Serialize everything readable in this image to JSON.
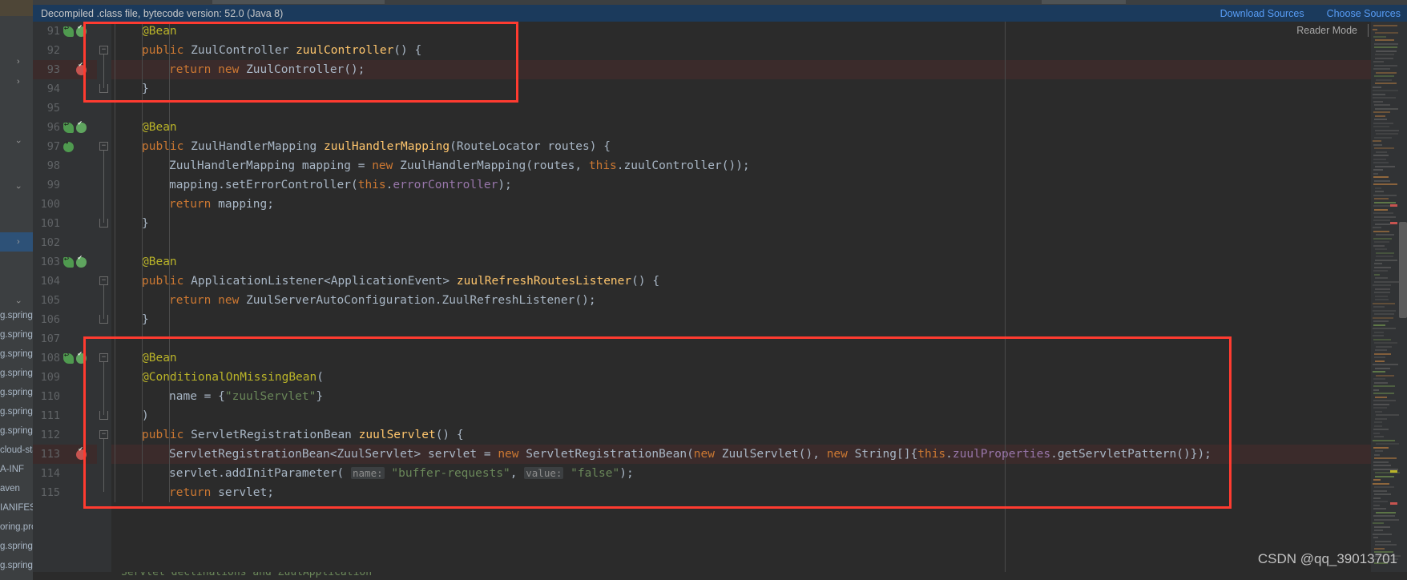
{
  "banner": {
    "message": "Decompiled .class file, bytecode version: 52.0 (Java 8)",
    "download_sources_label": "Download Sources",
    "choose_sources_label": "Choose Sources"
  },
  "editor": {
    "reader_mode_label": "Reader Mode",
    "first_line_number": 91,
    "lines": [
      {
        "num": "91",
        "indent": 1,
        "html": "<span class=\"anno\">@Bean</span>"
      },
      {
        "num": "92",
        "indent": 1,
        "html": "<span class=\"kw\">public</span> <span class=\"type\">ZuulController</span> <span class=\"mname\">zuulController</span><span class=\"punct\">() {</span>"
      },
      {
        "num": "93",
        "indent": 2,
        "html": "<span class=\"kw\">return</span> <span class=\"kw\">new</span> <span class=\"type\">ZuulController</span><span class=\"punct\">();</span>"
      },
      {
        "num": "94",
        "indent": 1,
        "html": "<span class=\"punct\">}</span>"
      },
      {
        "num": "95",
        "indent": 0,
        "html": ""
      },
      {
        "num": "96",
        "indent": 1,
        "html": "<span class=\"anno\">@Bean</span>"
      },
      {
        "num": "97",
        "indent": 1,
        "html": "<span class=\"kw\">public</span> <span class=\"type\">ZuulHandlerMapping</span> <span class=\"mname\">zuulHandlerMapping</span><span class=\"punct\">(</span><span class=\"type\">RouteLocator</span> <span class=\"ident\">routes</span><span class=\"punct\">) {</span>"
      },
      {
        "num": "98",
        "indent": 2,
        "html": "<span class=\"type\">ZuulHandlerMapping</span> <span class=\"ident\">mapping</span> <span class=\"punct\">=</span> <span class=\"kw\">new</span> <span class=\"type\">ZuulHandlerMapping</span><span class=\"punct\">(</span><span class=\"ident\">routes</span><span class=\"punct\">,</span> <span class=\"kw\">this</span><span class=\"punct\">.</span><span class=\"ident\">zuulController</span><span class=\"punct\">());</span>"
      },
      {
        "num": "99",
        "indent": 2,
        "html": "<span class=\"ident\">mapping</span><span class=\"punct\">.</span><span class=\"ident\">setErrorController</span><span class=\"punct\">(</span><span class=\"kw\">this</span><span class=\"punct\">.</span><span class=\"field\">errorController</span><span class=\"punct\">);</span>"
      },
      {
        "num": "100",
        "indent": 2,
        "html": "<span class=\"kw\">return</span> <span class=\"ident\">mapping</span><span class=\"punct\">;</span>"
      },
      {
        "num": "101",
        "indent": 1,
        "html": "<span class=\"punct\">}</span>"
      },
      {
        "num": "102",
        "indent": 0,
        "html": ""
      },
      {
        "num": "103",
        "indent": 1,
        "html": "<span class=\"anno\">@Bean</span>"
      },
      {
        "num": "104",
        "indent": 1,
        "html": "<span class=\"kw\">public</span> <span class=\"type\">ApplicationListener&lt;ApplicationEvent&gt;</span> <span class=\"mname\">zuulRefreshRoutesListener</span><span class=\"punct\">() {</span>"
      },
      {
        "num": "105",
        "indent": 2,
        "html": "<span class=\"kw\">return</span> <span class=\"kw\">new</span> <span class=\"type\">ZuulServerAutoConfiguration</span><span class=\"punct\">.</span><span class=\"type\">ZuulRefreshListener</span><span class=\"punct\">();</span>"
      },
      {
        "num": "106",
        "indent": 1,
        "html": "<span class=\"punct\">}</span>"
      },
      {
        "num": "107",
        "indent": 0,
        "html": ""
      },
      {
        "num": "108",
        "indent": 1,
        "html": "<span class=\"anno\">@Bean</span>"
      },
      {
        "num": "109",
        "indent": 1,
        "html": "<span class=\"anno\">@ConditionalOnMissingBean</span><span class=\"punct\">(</span>"
      },
      {
        "num": "110",
        "indent": 2,
        "html": "<span class=\"ident\">name</span> <span class=\"punct\">= {</span><span class=\"str\">\"zuulServlet\"</span><span class=\"punct\">}</span>"
      },
      {
        "num": "111",
        "indent": 1,
        "html": "<span class=\"punct\">)</span>"
      },
      {
        "num": "112",
        "indent": 1,
        "html": "<span class=\"kw\">public</span> <span class=\"type\">ServletRegistrationBean</span> <span class=\"mname\">zuulServlet</span><span class=\"punct\">() {</span>"
      },
      {
        "num": "113",
        "indent": 2,
        "html": "<span class=\"type\">ServletRegistrationBean&lt;ZuulServlet&gt;</span> <span class=\"ident\">servlet</span> <span class=\"punct\">=</span> <span class=\"kw\">new</span> <span class=\"type\">ServletRegistrationBean</span><span class=\"punct\">(</span><span class=\"kw\">new</span> <span class=\"type\">ZuulServlet</span><span class=\"punct\">(),</span> <span class=\"kw\">new</span> <span class=\"type\">String</span><span class=\"punct\">[]{</span><span class=\"kw\">this</span><span class=\"punct\">.</span><span class=\"field\">zuulProperties</span><span class=\"punct\">.</span><span class=\"ident\">getServletPattern</span><span class=\"punct\">()});</span>"
      },
      {
        "num": "114",
        "indent": 2,
        "html": "<span class=\"ident\">servlet</span><span class=\"punct\">.</span><span class=\"ident\">addInitParameter</span><span class=\"punct\">(</span> <span class=\"hintbg\">name:</span> <span class=\"str\">\"buffer-requests\"</span><span class=\"punct\">,</span> <span class=\"hintbg\">value:</span> <span class=\"str\">\"false\"</span><span class=\"punct\">);</span>"
      },
      {
        "num": "115",
        "indent": 2,
        "html": "<span class=\"kw\">return</span> <span class=\"ident\">servlet</span><span class=\"punct\">;</span>"
      }
    ],
    "highlighted_lines": [
      "93",
      "113"
    ],
    "breakpoint_lines": [
      "93",
      "113"
    ],
    "code_plain": {
      "91": "@Bean",
      "92": "public ZuulController zuulController() {",
      "93": "    return new ZuulController();",
      "94": "}",
      "95": "",
      "96": "@Bean",
      "97": "public ZuulHandlerMapping zuulHandlerMapping(RouteLocator routes) {",
      "98": "    ZuulHandlerMapping mapping = new ZuulHandlerMapping(routes, this.zuulController());",
      "99": "    mapping.setErrorController(this.errorController);",
      "100": "    return mapping;",
      "101": "}",
      "102": "",
      "103": "@Bean",
      "104": "public ApplicationListener<ApplicationEvent> zuulRefreshRoutesListener() {",
      "105": "    return new ZuulServerAutoConfiguration.ZuulRefreshListener();",
      "106": "}",
      "107": "",
      "108": "@Bean",
      "109": "@ConditionalOnMissingBean(",
      "110": "    name = {\"zuulServlet\"}",
      "111": ")",
      "112": "public ServletRegistrationBean zuulServlet() {",
      "113": "    ServletRegistrationBean<ZuulServlet> servlet = new ServletRegistrationBean(new ZuulServlet(), new String[]{this.zuulProperties.getServletPattern()});",
      "114": "    servlet.addInitParameter( name: \"buffer-requests\",  value: \"false\");",
      "115": "    return servlet;"
    }
  },
  "bottom_partial_line": "Servlet declinations and ZuulApplication",
  "sidebar": {
    "items": [
      "g.springf",
      "g.springf",
      "g.springf",
      "g.springf",
      "g.springf",
      "g.springf",
      "g.springf",
      "cloud-sta",
      "A-INF",
      "aven",
      "IANIFES",
      "oring.pro",
      "g.springf",
      "g.springf"
    ]
  },
  "watermark": "CSDN @qq_39013701",
  "colors": {
    "banner_bg": "#1b3a5c",
    "link": "#589df6",
    "editor_bg": "#2b2b2b",
    "gutter_bg": "#313335",
    "annotation_red": "#ff3b30",
    "keyword": "#cc7832",
    "annotation_token": "#bbb529",
    "method": "#ffc66d",
    "string": "#6a8759",
    "field": "#9876aa",
    "default_text": "#a9b7c6",
    "highlight_row": "#3b2b2b"
  },
  "annotations": [
    {
      "name": "zuulController-bean-box",
      "lines": "91-94"
    },
    {
      "name": "zuulServlet-bean-box",
      "lines": "107-115"
    }
  ]
}
